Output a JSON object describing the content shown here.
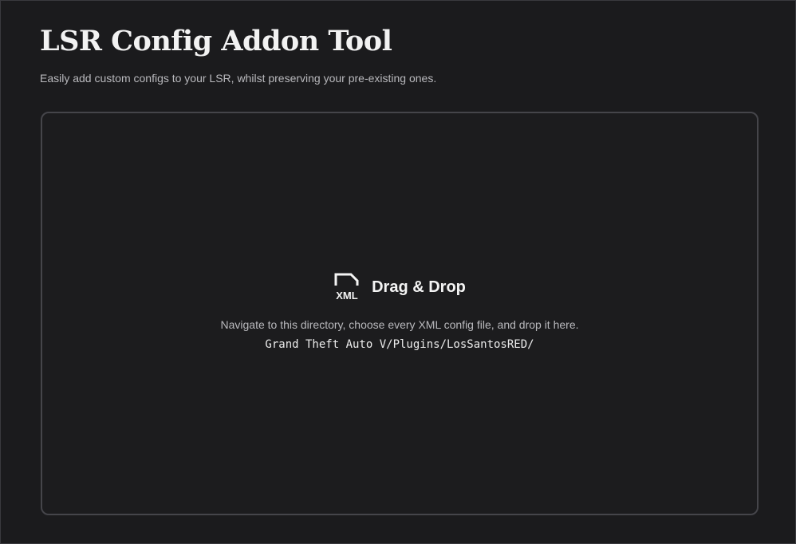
{
  "header": {
    "title": "LSR Config Addon Tool",
    "subtitle": "Easily add custom configs to your LSR, whilst preserving your pre-existing ones."
  },
  "dropzone": {
    "icon": "xml-file-icon",
    "icon_label": "XML",
    "heading": "Drag & Drop",
    "instructions": "Navigate to this directory, choose every XML config file, and drop it here.",
    "path": "Grand Theft Auto V/Plugins/LosSantosRED/"
  },
  "colors": {
    "background": "#1b1b1d",
    "border": "#45454a",
    "text": "#ececec",
    "muted": "#b9b9bd"
  }
}
